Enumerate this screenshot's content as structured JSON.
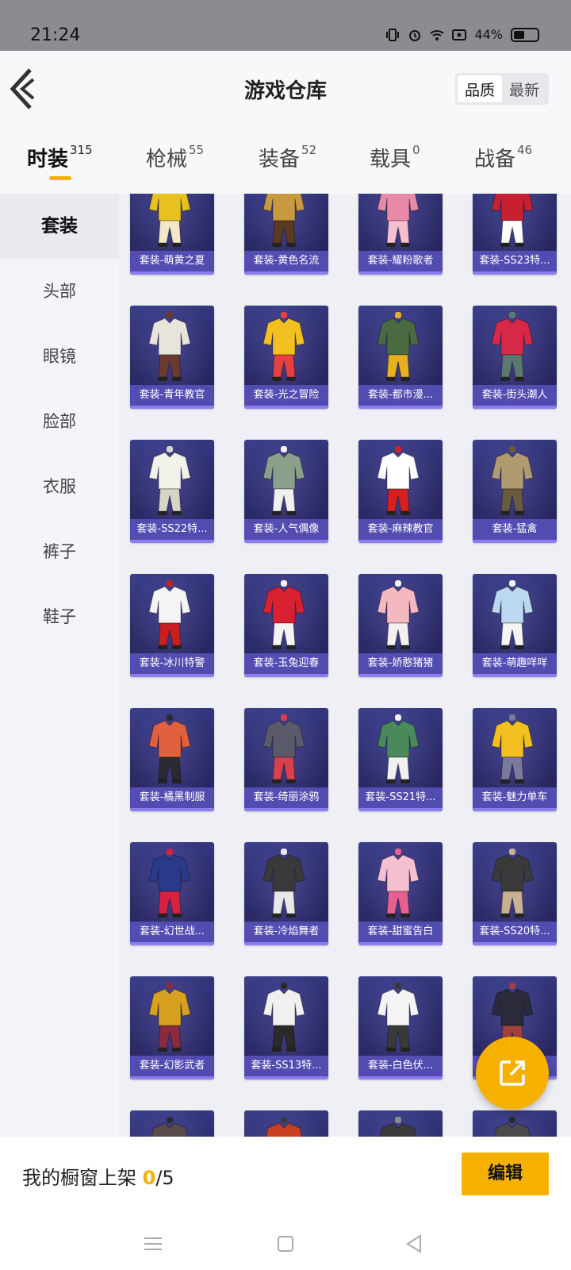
{
  "status_bar": {
    "time": "21:24",
    "battery": "44%"
  },
  "header": {
    "title": "游戏仓库",
    "sort_options": [
      "品质",
      "最新"
    ],
    "sort_active": 0
  },
  "tabs": [
    {
      "label": "时装",
      "count": "315"
    },
    {
      "label": "枪械",
      "count": "55"
    },
    {
      "label": "装备",
      "count": "52"
    },
    {
      "label": "载具",
      "count": "0"
    },
    {
      "label": "战备",
      "count": "46"
    }
  ],
  "sidebar": {
    "items": [
      "套装",
      "头部",
      "眼镜",
      "脸部",
      "衣服",
      "裤子",
      "鞋子"
    ],
    "active": 0
  },
  "items": [
    {
      "name": "套装-萌黄之夏",
      "palette": [
        "#e8c020",
        "#f2e8c8"
      ]
    },
    {
      "name": "套装-黄色名流",
      "palette": [
        "#c89a40",
        "#5a3a20"
      ]
    },
    {
      "name": "套装-耀粉歌者",
      "palette": [
        "#e889a8",
        "#f4c0d0"
      ]
    },
    {
      "name": "套装-SS23特...",
      "palette": [
        "#c82030",
        "#ffffff"
      ]
    },
    {
      "name": "套装-青年教官",
      "palette": [
        "#e8e4dc",
        "#6a3a30"
      ]
    },
    {
      "name": "套装-光之冒险",
      "palette": [
        "#f2c020",
        "#e84040"
      ]
    },
    {
      "name": "套装-都市漫...",
      "palette": [
        "#4a6a40",
        "#e8b020"
      ]
    },
    {
      "name": "套装-街头潮人",
      "palette": [
        "#d82848",
        "#5a7a70"
      ]
    },
    {
      "name": "套装-SS22特...",
      "palette": [
        "#f2f2ea",
        "#d8d4c8"
      ]
    },
    {
      "name": "套装-人气偶像",
      "palette": [
        "#8aa08a",
        "#f0f0f0"
      ]
    },
    {
      "name": "套装-麻辣教官",
      "palette": [
        "#ffffff",
        "#d82020"
      ]
    },
    {
      "name": "套装-猛禽",
      "palette": [
        "#b09a70",
        "#6a5a40"
      ]
    },
    {
      "name": "套装-冰川特警",
      "palette": [
        "#f4f4f4",
        "#c82020"
      ]
    },
    {
      "name": "套装-玉兔迎春",
      "palette": [
        "#d82030",
        "#f4f4f4"
      ]
    },
    {
      "name": "套装-娇憨猪猪",
      "palette": [
        "#f4b8c0",
        "#f4f0f0"
      ]
    },
    {
      "name": "套装-萌趣咩咩",
      "palette": [
        "#bcd8f0",
        "#f4f4f4"
      ]
    },
    {
      "name": "套装-橘黑制服",
      "palette": [
        "#e06040",
        "#2a2a30"
      ]
    },
    {
      "name": "套装-绮丽涂鸦",
      "palette": [
        "#5a5a6a",
        "#d84050"
      ]
    },
    {
      "name": "套装-SS21特...",
      "palette": [
        "#4a8a5a",
        "#f0f0f0"
      ]
    },
    {
      "name": "套装-魅力单车",
      "palette": [
        "#f2c020",
        "#7a7a9a"
      ]
    },
    {
      "name": "套装-幻世战...",
      "palette": [
        "#2a3a8a",
        "#d82040"
      ]
    },
    {
      "name": "套装-冷焰舞者",
      "palette": [
        "#3a3a3a",
        "#e8e8e8"
      ]
    },
    {
      "name": "套装-甜蜜告白",
      "palette": [
        "#f4c0d0",
        "#e86090"
      ]
    },
    {
      "name": "套装-SS20特...",
      "palette": [
        "#3a3a3a",
        "#c8b090"
      ]
    },
    {
      "name": "套装-幻影武者",
      "palette": [
        "#d8a020",
        "#8a2a40"
      ]
    },
    {
      "name": "套装-SS13特...",
      "palette": [
        "#f0f0f0",
        "#2a2a2a"
      ]
    },
    {
      "name": "套装-白色伏...",
      "palette": [
        "#f4f4f4",
        "#3a3a3a"
      ]
    },
    {
      "name": "套装-...",
      "palette": [
        "#2a2a3a",
        "#a04040"
      ]
    },
    {
      "name": "",
      "palette": [
        "#5a4a4a",
        "#2a2a2a"
      ]
    },
    {
      "name": "",
      "palette": [
        "#c84020",
        "#3a3a3a"
      ]
    },
    {
      "name": "",
      "palette": [
        "#3a3a3a",
        "#8a8a8a"
      ]
    },
    {
      "name": "",
      "palette": [
        "#4a4a4a",
        "#2a2a2a"
      ]
    }
  ],
  "bottom": {
    "showcase_label": "我的橱窗上架 ",
    "showcase_current": "0",
    "showcase_total": "/5",
    "edit_label": "编辑"
  }
}
